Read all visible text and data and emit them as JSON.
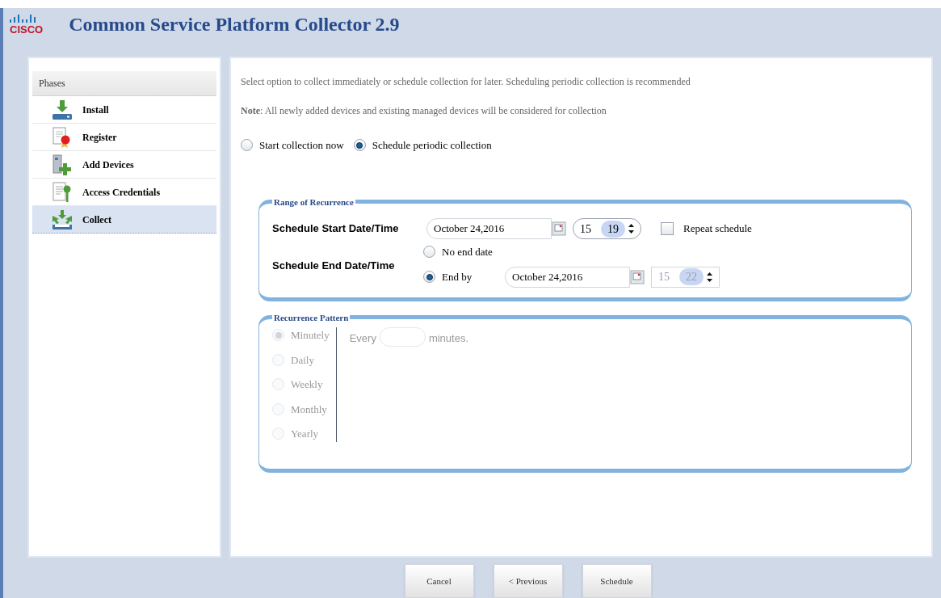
{
  "header": {
    "logo": "CISCO",
    "title": "Common Service Platform Collector 2.9"
  },
  "phases": {
    "title": "Phases",
    "items": [
      {
        "label": "Install",
        "kind": "install",
        "selected": false
      },
      {
        "label": "Register",
        "kind": "register",
        "selected": false
      },
      {
        "label": "Add Devices",
        "kind": "devices",
        "selected": false
      },
      {
        "label": "Access Credentials",
        "kind": "credentials",
        "selected": false
      },
      {
        "label": "Collect",
        "kind": "collect",
        "selected": true
      }
    ]
  },
  "intro": "Select option to collect immediately or schedule collection for later. Scheduling periodic collection is recommended",
  "note": "**Note**: All newly added devices and existing managed devices will be considered for collection",
  "collection_mode": [
    {
      "label": "Start collection now",
      "selected": false
    },
    {
      "label": "Schedule periodic collection",
      "selected": true
    }
  ],
  "range": {
    "legend": "Range of Recurrence",
    "start": {
      "label": "Schedule Start Date/Time",
      "date": "October 24,2016",
      "hour": "15",
      "minute": "19",
      "disabled": false
    },
    "repeat": {
      "label": "Repeat schedule",
      "checked": false
    },
    "end": {
      "label": "Schedule End Date/Time",
      "options": [
        {
          "label": "No end date",
          "selected": false
        },
        {
          "label": "End by",
          "selected": true
        }
      ],
      "date": "October 24,2016",
      "hour": "15",
      "minute": "22",
      "disabled": true
    }
  },
  "pattern": {
    "legend": "Recurrence Pattern",
    "disabled": true,
    "options": [
      {
        "label": "Minutely",
        "selected": true
      },
      {
        "label": "Daily",
        "selected": false
      },
      {
        "label": "Weekly",
        "selected": false
      },
      {
        "label": "Monthly",
        "selected": false
      },
      {
        "label": "Yearly",
        "selected": false
      }
    ],
    "every": "Every",
    "unit": "minutes."
  },
  "buttons": [
    {
      "label": "Cancel"
    },
    {
      "label": "< Previous"
    },
    {
      "label": "Schedule"
    }
  ]
}
